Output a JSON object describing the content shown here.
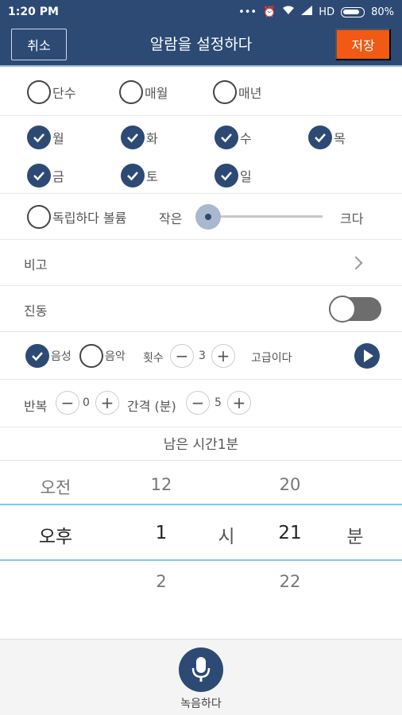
{
  "status": {
    "time": "1:20 PM",
    "network": "HD",
    "battery": "80%"
  },
  "header": {
    "cancel": "취소",
    "title": "알람을 설정하다",
    "save": "저장"
  },
  "repeat_type": {
    "options": [
      "단수",
      "매월",
      "매년"
    ]
  },
  "weekdays": {
    "days": [
      "월",
      "화",
      "수",
      "목",
      "금",
      "토",
      "일"
    ],
    "checked": [
      true,
      true,
      true,
      true,
      true,
      true,
      true
    ]
  },
  "volume": {
    "independent_label": "독립하다 볼륨",
    "small_label": "작은",
    "big_label": "크다",
    "level": 0.0
  },
  "note": {
    "label": "비고"
  },
  "vibration": {
    "label": "진동",
    "on": false
  },
  "sound": {
    "voice_label": "음성",
    "voice_checked": true,
    "music_label": "음악",
    "music_checked": false,
    "count_label": "횟수",
    "count_value": "3",
    "advanced_label": "고급이다"
  },
  "repeat": {
    "label": "반복",
    "value": "0",
    "interval_label": "간격 (분)",
    "interval_value": "5"
  },
  "remaining": "남은 시간1분",
  "picker": {
    "ampm": {
      "prev": "오전",
      "current": "오후"
    },
    "hour": {
      "prev": "12",
      "current": "1",
      "next": "2"
    },
    "hour_unit": "시",
    "minute": {
      "prev": "20",
      "current": "21",
      "next": "22"
    },
    "minute_unit": "분"
  },
  "record": {
    "label": "녹음하다"
  },
  "colors": {
    "primary": "#2c4a74",
    "accent": "#f05a14",
    "picker_line": "#7fc5ef"
  }
}
